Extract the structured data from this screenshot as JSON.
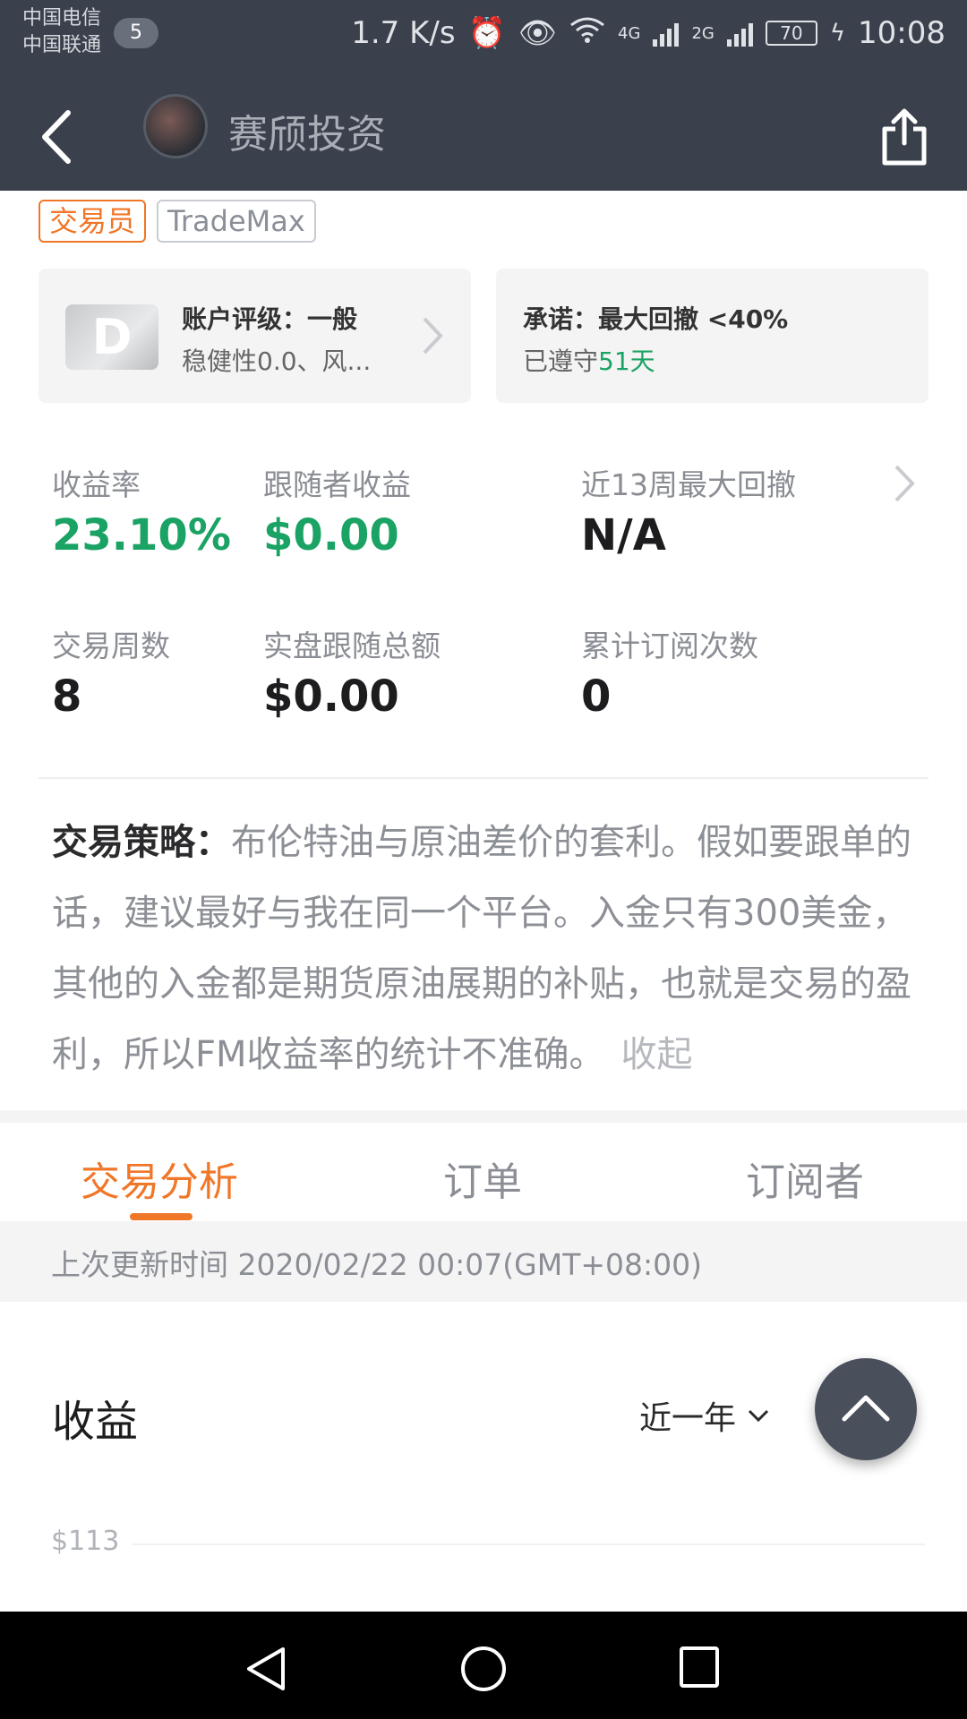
{
  "status_bar": {
    "carrier_1": "中国电信",
    "carrier_2": "中国联通",
    "notification_count": "5",
    "speed": "1.7 K/s",
    "network_1": "4G",
    "network_2": "2G",
    "battery": "70",
    "time": "10:08"
  },
  "nav": {
    "title": "赛颀投资"
  },
  "tags": [
    "交易员",
    "TradeMax"
  ],
  "rating_card": {
    "badge": "D",
    "title": "账户评级：一般",
    "subtitle": "稳健性0.0、风..."
  },
  "commitment_card": {
    "title": "承诺：最大回撤 <40%",
    "sub_prefix": "已遵守",
    "sub_value": "51天"
  },
  "stats": [
    {
      "label": "收益率",
      "value": "23.10%"
    },
    {
      "label": "跟随者收益",
      "value": "$0.00"
    },
    {
      "label": "近13周最大回撤",
      "value": "N/A"
    },
    {
      "label": "交易周数",
      "value": "8"
    },
    {
      "label": "实盘跟随总额",
      "value": "$0.00"
    },
    {
      "label": "累计订阅次数",
      "value": "0"
    }
  ],
  "strategy": {
    "label": "交易策略：",
    "text": "布伦特油与原油差价的套利。假如要跟单的话，建议最好与我在同一个平台。入金只有300美金，其他的入金都是期货原油展期的补贴，也就是交易的盈利，所以FM收益率的统计不准确。",
    "collapse": "收起"
  },
  "tabs": [
    "交易分析",
    "订单",
    "订阅者"
  ],
  "update_text": "上次更新时间 2020/02/22 00:07(GMT+08:00)",
  "profit_section": {
    "title": "收益",
    "range": "近一年",
    "y_label": "$113"
  },
  "colors": {
    "accent": "#f07628",
    "positive": "#1aa364",
    "header": "#3b414c"
  }
}
